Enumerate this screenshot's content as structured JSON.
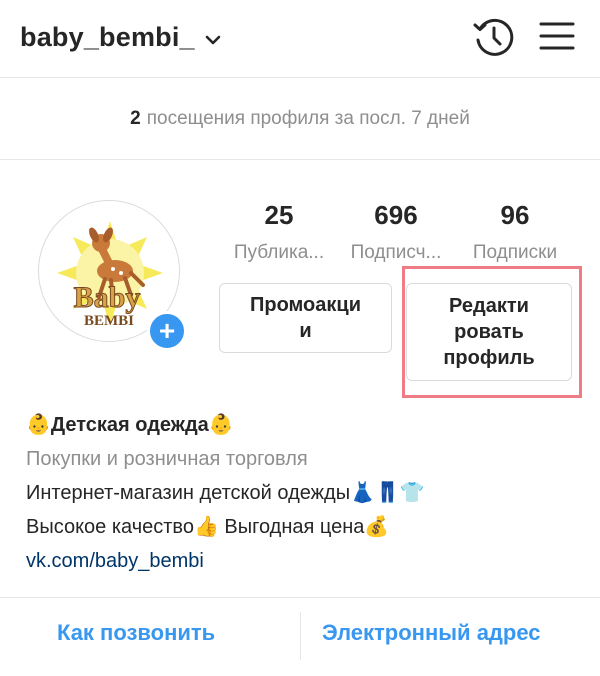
{
  "header": {
    "username": "baby_bembi_",
    "icons": [
      "chevron-down-icon",
      "history-icon",
      "menu-icon"
    ]
  },
  "visits": {
    "count": "2",
    "text": "посещения профиля за посл. 7 дней"
  },
  "avatar": {
    "logo_line1": "Baby",
    "logo_line2": "BEMBI",
    "add_label": "+"
  },
  "stats": [
    {
      "value": "25",
      "label": "Публика..."
    },
    {
      "value": "696",
      "label": "Подписч..."
    },
    {
      "value": "96",
      "label": "Подписки"
    }
  ],
  "buttons": {
    "promo": [
      "Промоакци",
      "и"
    ],
    "edit": [
      "Редакти",
      "ровать",
      "профиль"
    ]
  },
  "bio": {
    "name": "Детская одежда",
    "category": "Покупки и розничная торговля",
    "line1": "Интернет-магазин детской одежды",
    "line2a": "Высокое качество",
    "line2b": " Выгодная цена",
    "link": "vk.com/baby_bembi"
  },
  "actions": {
    "call": "Как позвонить",
    "email": "Электронный адрес"
  },
  "colors": {
    "accent": "#3897f0",
    "highlight": "#f07c86",
    "muted": "#8e8e8e",
    "link": "#003569"
  }
}
